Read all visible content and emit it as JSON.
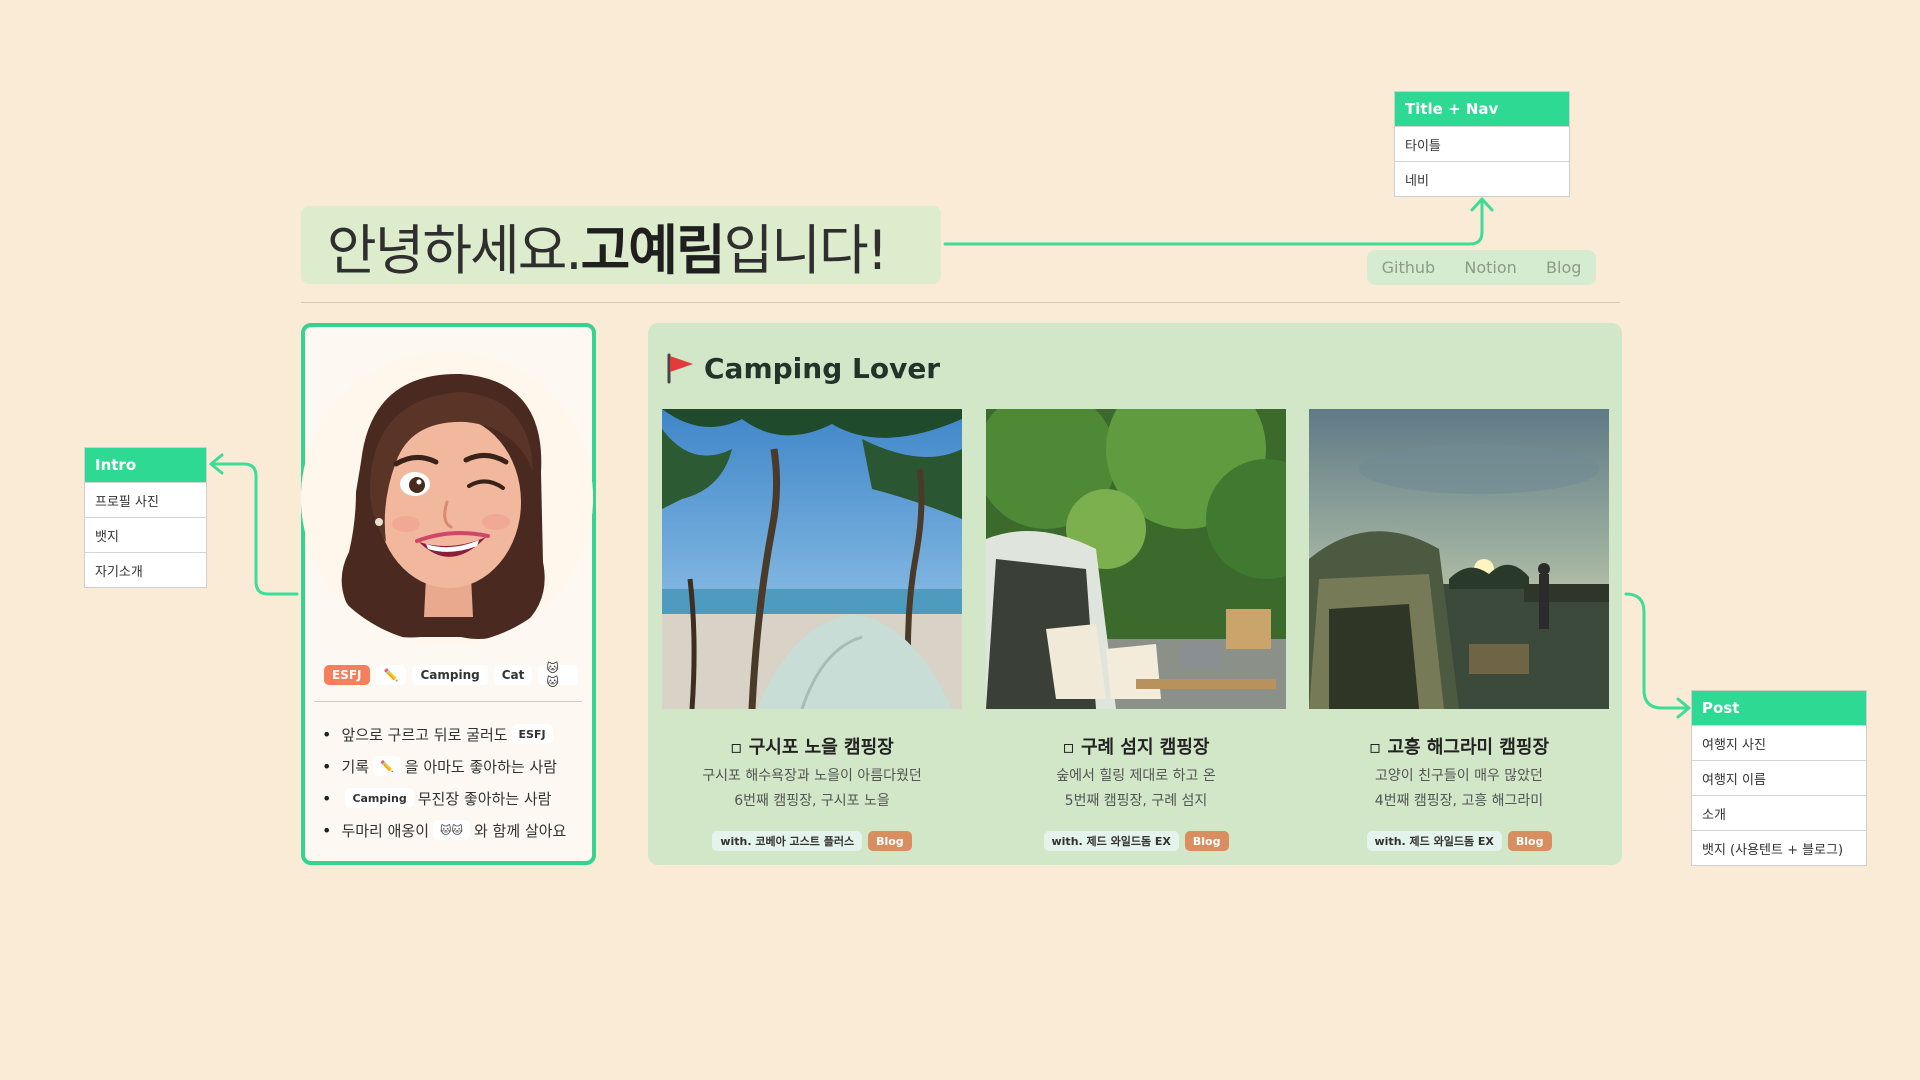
{
  "title": {
    "prefix": "안녕하세요. ",
    "name": "고예림",
    "suffix": "입니다!"
  },
  "nav": [
    "Github",
    "Notion",
    "Blog"
  ],
  "profile": {
    "badges": [
      {
        "label": "ESFJ",
        "type": "esfj"
      },
      {
        "label": "✏️",
        "type": "default"
      },
      {
        "label": "Camping",
        "type": "default"
      },
      {
        "label": "Cat",
        "type": "default"
      },
      {
        "label": "🐱🐱",
        "type": "default"
      }
    ],
    "intro": [
      {
        "before": "앞으로 구르고 뒤로 굴러도",
        "chip": "ESFJ",
        "after": ""
      },
      {
        "before": "기록",
        "chip": "✏️",
        "after": "을 아마도 좋아하는 사람"
      },
      {
        "before": "",
        "chip": "Camping",
        "after": "무진장 좋아하는 사람"
      },
      {
        "before": "두마리 애옹이",
        "chip": "🐱🐱",
        "after": "와 함께 살아요"
      }
    ]
  },
  "camping": {
    "heading": "Camping Lover",
    "posts": [
      {
        "title": "구시포 노을 캠핑장",
        "desc1": "구시포 해수욕장과 노을이 아름다웠던",
        "desc2": "6번째 캠핑장, 구시포 노을",
        "with": "with. 코베아 고스트 플러스",
        "blog": "Blog"
      },
      {
        "title": "구례 섬지 캠핑장",
        "desc1": "숲에서 힐링 제대로 하고 온",
        "desc2": "5번째 캠핑장, 구례 섬지",
        "with": "with. 제드 와일드돔 EX",
        "blog": "Blog"
      },
      {
        "title": "고흥 해그라미 캠핑장",
        "desc1": "고양이 친구들이 매우 많았던",
        "desc2": "4번째 캠핑장, 고흥 해그라미",
        "with": "with. 제드 와일드돔 EX",
        "blog": "Blog"
      }
    ]
  },
  "annotations": {
    "title_nav": {
      "header": "Title + Nav",
      "rows": [
        "타이틀",
        "네비"
      ]
    },
    "intro": {
      "header": "Intro",
      "rows": [
        "프로필 사진",
        "뱃지",
        "자기소개"
      ]
    },
    "post": {
      "header": "Post",
      "rows": [
        "여행지 사진",
        "여행지 이름",
        "소개",
        "뱃지 (사용텐트 + 블로그)"
      ]
    }
  },
  "colors": {
    "background": "#faebd7",
    "accent_green": "#2ed993",
    "card_border": "#36d38f",
    "section_bg": "#d2e7c7",
    "title_bg": "#ddeccc",
    "esfj_badge": "#f57e5d",
    "blog_badge": "#d88e5f"
  }
}
